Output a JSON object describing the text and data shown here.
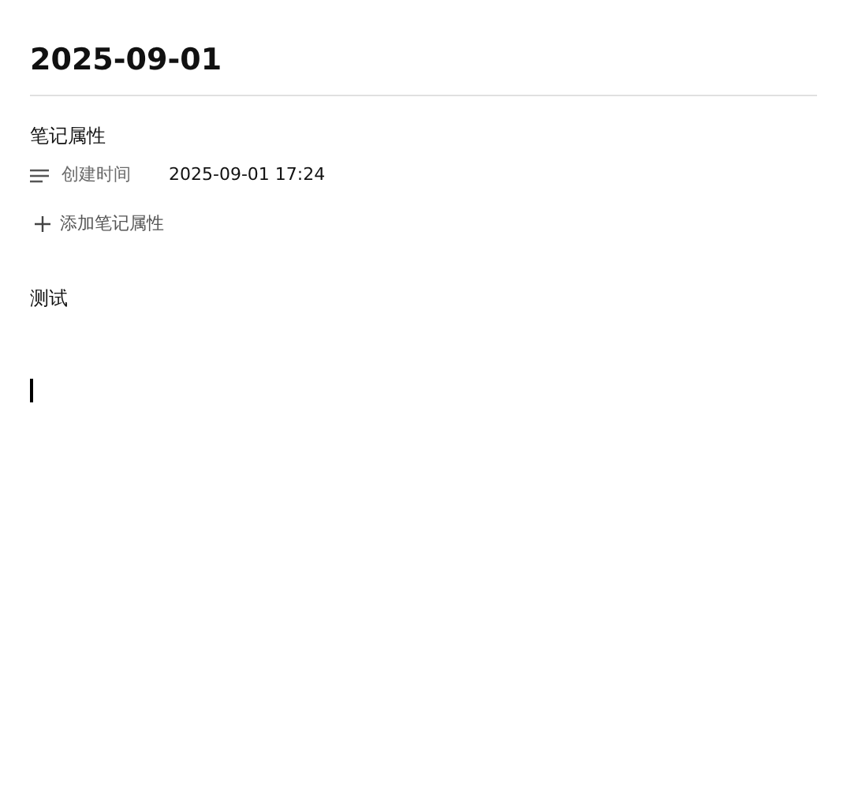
{
  "title": "2025-09-01",
  "properties": {
    "heading": "笔记属性",
    "items": [
      {
        "name": "创建时间",
        "value": "2025-09-01 17:24"
      }
    ],
    "add_label": "添加笔记属性"
  },
  "body": {
    "paragraph": "测试",
    "cursor": true
  }
}
